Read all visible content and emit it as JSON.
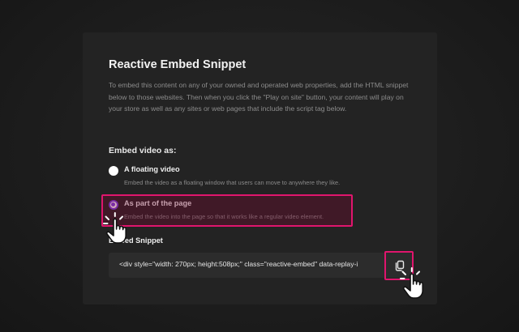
{
  "card": {
    "title": "Reactive Embed Snippet",
    "description": "To embed this content on any of your owned and operated web properties, add the HTML snippet below to those websites. Then when you click the \"Play on site\" button, your content will play on your store as well as any sites or web pages that include the script tag below."
  },
  "embed_as": {
    "label": "Embed video as:",
    "options": [
      {
        "label": "A floating video",
        "description": "Embed the video as a floating window that users can move to anywhere they like.",
        "selected": false
      },
      {
        "label": "As part of the page",
        "description": "Embed the video into the page so that it works like a regular video element.",
        "selected": true
      }
    ]
  },
  "snippet": {
    "label": "Embed Snippet",
    "code": "<div style=\"width: 270px; height:508px;\" class=\"reactive-embed\" data-replay-i"
  },
  "colors": {
    "accent": "#7b3fe4",
    "highlight": "#e0156d"
  },
  "icons": {
    "copy": "copy-icon",
    "cursor": "hand-pointer-icon"
  }
}
